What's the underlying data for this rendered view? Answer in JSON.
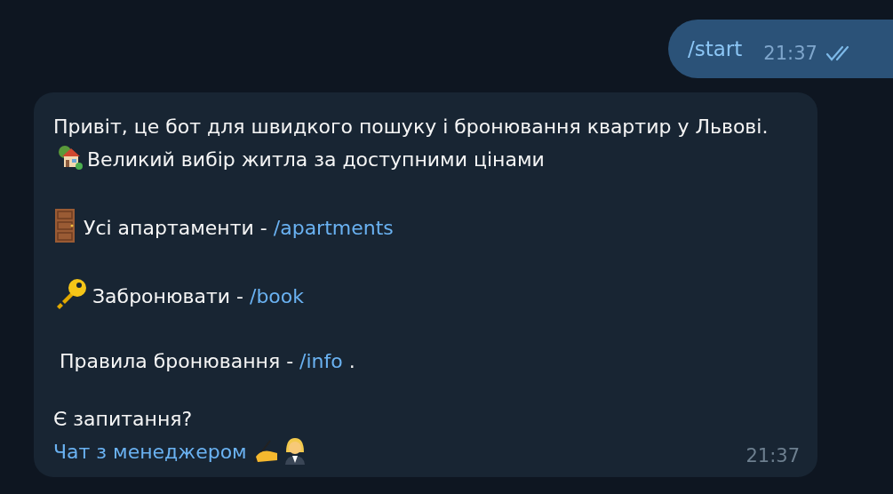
{
  "messages": [
    {
      "kind": "outgoing",
      "text": "/start",
      "time": "21:37",
      "read": true
    },
    {
      "kind": "incoming",
      "time": "21:37",
      "blocks": [
        {
          "parts": [
            {
              "kind": "text",
              "text": "Привіт, це бот для швидкого пошуку і бронювання квартир у Львові."
            },
            {
              "kind": "emoji"
            },
            {
              "kind": "text",
              "text": "Великий вибір житла за доступними цінами"
            }
          ]
        },
        {
          "parts": [
            {
              "kind": "emoji"
            },
            {
              "kind": "text",
              "text": "Усі апартаменти - "
            },
            {
              "kind": "link",
              "text": "/apartments"
            }
          ]
        },
        {
          "parts": [
            {
              "kind": "emoji"
            },
            {
              "kind": "text",
              "text": "Забронювати - "
            },
            {
              "kind": "link",
              "text": "/book"
            }
          ]
        },
        {
          "parts": [
            {
              "kind": "text",
              "text": " Правила бронювання - "
            },
            {
              "kind": "link",
              "text": "/info"
            },
            {
              "kind": "text",
              "text": " ."
            }
          ]
        },
        {
          "parts": [
            {
              "kind": "text",
              "text": "Є запитання?"
            }
          ]
        },
        {
          "parts": [
            {
              "kind": "link",
              "text": "Чат з менеджером"
            },
            {
              "kind": "emoji"
            },
            {
              "kind": "emoji"
            }
          ]
        }
      ]
    }
  ]
}
